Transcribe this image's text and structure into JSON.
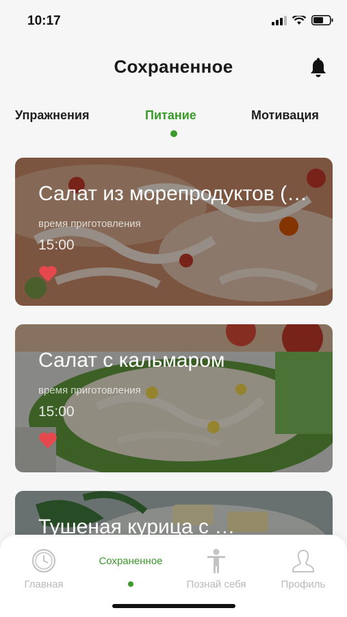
{
  "status_bar": {
    "time": "10:17"
  },
  "header": {
    "title": "Сохраненное",
    "bell_icon": "bell-icon"
  },
  "tabs": [
    {
      "label": "Упражнения",
      "active": false
    },
    {
      "label": "Питание",
      "active": true
    },
    {
      "label": "Мотивация",
      "active": false
    }
  ],
  "cards": [
    {
      "title": "Салат из морепродуктов (…",
      "subtitle": "время приготовления",
      "time": "15:00",
      "favorite": true
    },
    {
      "title": "Салат с кальмаром",
      "subtitle": "время приготовления",
      "time": "15:00",
      "favorite": true
    },
    {
      "title": "Тушеная курица с …",
      "subtitle": "",
      "time": "",
      "favorite": false
    }
  ],
  "bottom_nav": [
    {
      "label": "Главная",
      "icon": "clock-icon",
      "active": false
    },
    {
      "label": "Сохраненное",
      "icon": "",
      "active": true
    },
    {
      "label": "Познай себя",
      "icon": "person-icon",
      "active": false
    },
    {
      "label": "Профиль",
      "icon": "profile-icon",
      "active": false
    }
  ],
  "colors": {
    "accent": "#3a9a2a",
    "heart": "#e5484d",
    "inactive": "#b9b9b9"
  }
}
